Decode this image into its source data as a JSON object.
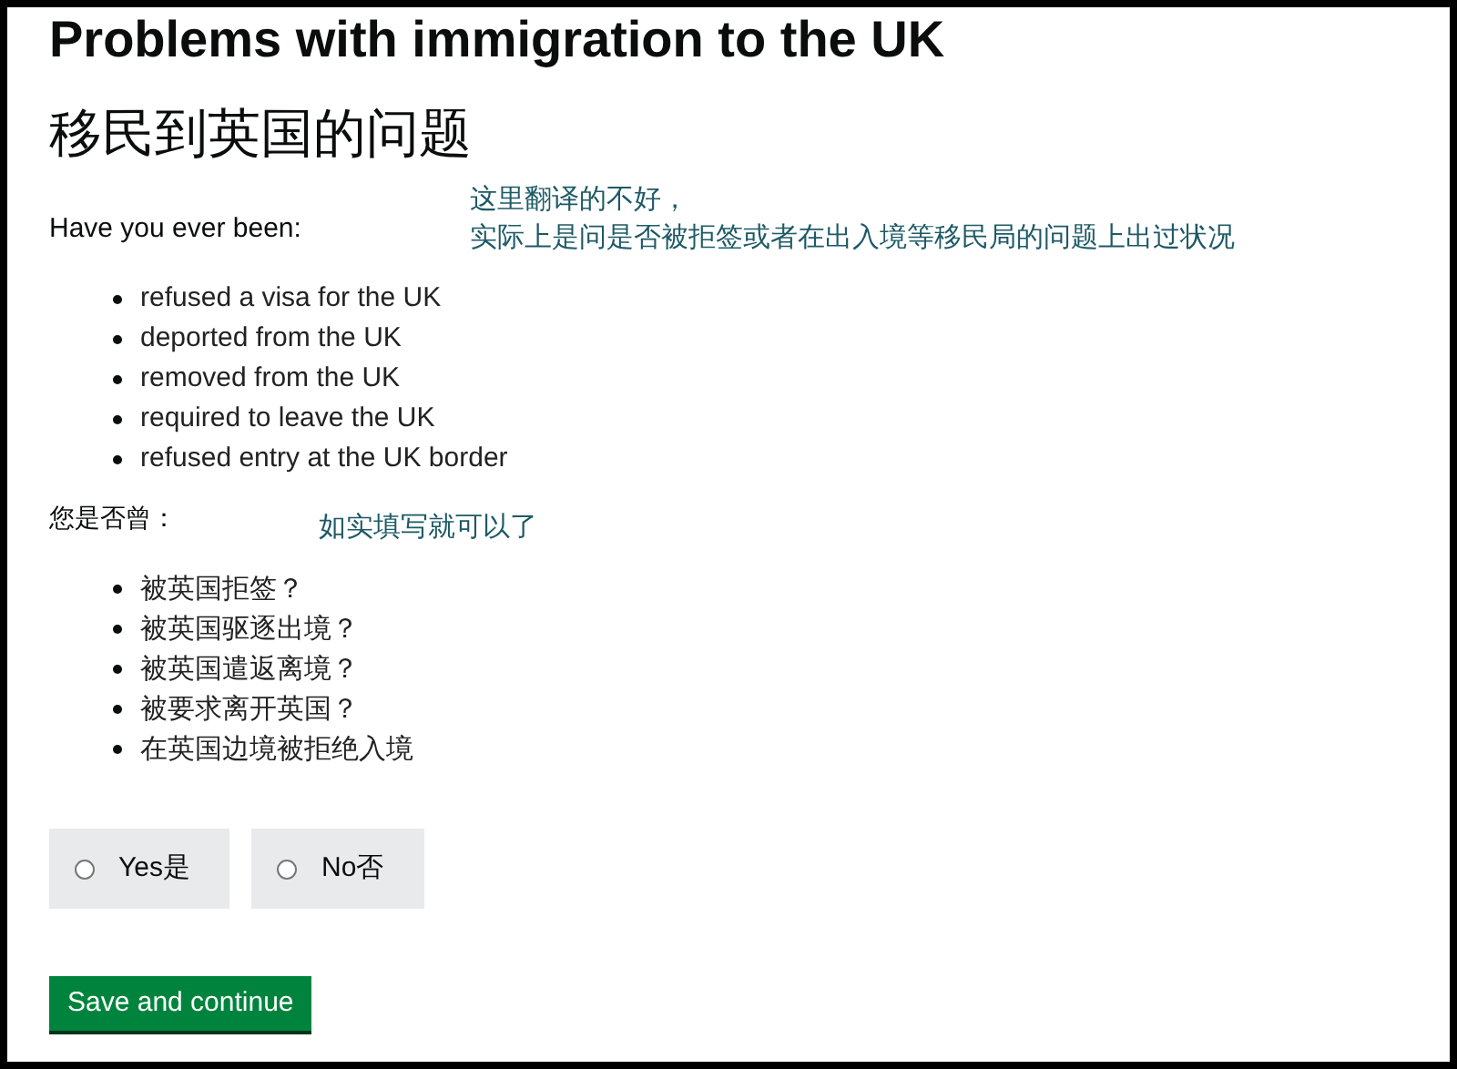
{
  "title": "Problems with immigration to the UK",
  "title_translation": "移民到英国的问题",
  "question_en": {
    "label": "Have you ever been:",
    "note_lines": [
      "这里翻译的不好，",
      "实际上是问是否被拒签或者在出入境等移民局的问题上出过状况"
    ]
  },
  "items_en": [
    "refused a visa for the UK",
    "deported from the UK",
    "removed from the UK",
    "required to leave the UK",
    "refused entry at the UK border"
  ],
  "question_zh": {
    "label": "您是否曾：",
    "note_lines": [
      "如实填写就可以了"
    ]
  },
  "items_zh": [
    "被英国拒签？",
    "被英国驱逐出境？",
    "被英国遣返离境？",
    "被要求离开英国？",
    "在英国边境被拒绝入境"
  ],
  "options": [
    {
      "label": "Yes是",
      "selected": false
    },
    {
      "label": "No否",
      "selected": false
    }
  ],
  "submit_button": "Save and continue"
}
